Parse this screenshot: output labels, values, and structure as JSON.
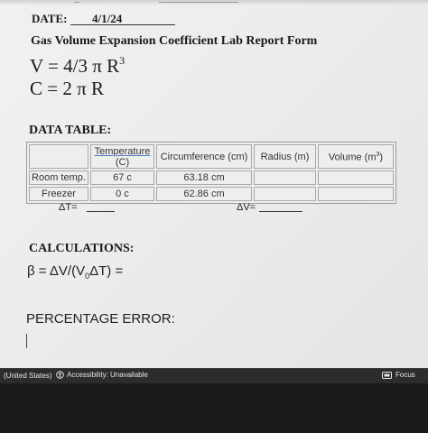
{
  "header": {
    "date_label": "DATE:",
    "date_value": "4/1/24",
    "form_title": "Gas Volume Expansion Coefficient Lab Report Form"
  },
  "formulas": {
    "volume": "V = 4/3 π R",
    "volume_exp": "3",
    "circumference": "C = 2 π R"
  },
  "data_table": {
    "title": "DATA TABLE:",
    "headers": {
      "temperature_line1": "Temperature",
      "temperature_line2": "(C)",
      "circumference": "Circumference (cm)",
      "radius": "Radius (m)",
      "volume": "Volume (m",
      "volume_exp": "3",
      "volume_close": ")"
    },
    "rows": [
      {
        "label": "Room temp.",
        "temperature": "67 c",
        "circumference": "63.18 cm",
        "radius": "",
        "volume": ""
      },
      {
        "label": "Freezer",
        "temperature": "0 c",
        "circumference": "62.86 cm",
        "radius": "",
        "volume": ""
      }
    ],
    "delta_t_label": "ΔT=",
    "delta_v_label": "ΔV="
  },
  "calculations": {
    "title": "CALCULATIONS:",
    "beta_prefix": "β = ΔV/(V",
    "beta_sub": "0",
    "beta_suffix": "ΔT) ="
  },
  "percentage_error": {
    "title": "PERCENTAGE ERROR:"
  },
  "statusbar": {
    "language": "(United States)",
    "accessibility": "Accessibility: Unavailable",
    "focus": "Focus"
  }
}
